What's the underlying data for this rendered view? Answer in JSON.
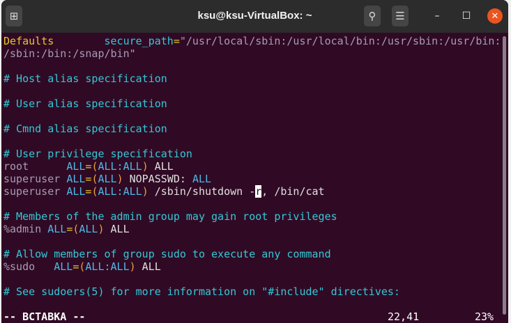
{
  "window": {
    "title": "ksu@ksu-VirtualBox: ~"
  },
  "titlebar": {
    "new_tab_icon": "new-tab-icon",
    "search_icon": "search-icon",
    "menu_icon": "hamburger-menu-icon",
    "minimize": "–",
    "maximize": "☐",
    "close": "✕"
  },
  "editor": {
    "lines": [
      [
        [
          "Defaults",
          "yellow"
        ],
        [
          "        ",
          "str"
        ],
        [
          "secure_path",
          "cyan"
        ],
        [
          "=",
          "op"
        ],
        [
          "\"/usr/local/sbin:/usr/local/bin:/usr/sbin:/usr/bin:",
          "str"
        ]
      ],
      [
        [
          "/sbin:/bin:/snap/bin\"",
          "str"
        ]
      ],
      [],
      [
        [
          "# Host alias specification",
          "cyan"
        ]
      ],
      [],
      [
        [
          "# User alias specification",
          "cyan"
        ]
      ],
      [],
      [
        [
          "# Cmnd alias specification",
          "cyan"
        ]
      ],
      [],
      [
        [
          "# User privilege specification",
          "cyan"
        ]
      ],
      [
        [
          "root      ",
          "str"
        ],
        [
          "ALL",
          "blue"
        ],
        [
          "=",
          "op"
        ],
        [
          "(",
          "paren"
        ],
        [
          "ALL:ALL",
          "blue"
        ],
        [
          ")",
          "paren"
        ],
        [
          " ALL",
          "plain"
        ]
      ],
      [
        [
          "superuser ",
          "str"
        ],
        [
          "ALL",
          "blue"
        ],
        [
          "=",
          "op"
        ],
        [
          "(",
          "paren"
        ],
        [
          "ALL",
          "blue"
        ],
        [
          ")",
          "paren"
        ],
        [
          " NOPASSWD",
          "plain"
        ],
        [
          ": ",
          "plain"
        ],
        [
          "ALL",
          "blue"
        ]
      ],
      [
        [
          "superuser ",
          "str"
        ],
        [
          "ALL",
          "blue"
        ],
        [
          "=",
          "op"
        ],
        [
          "(",
          "paren"
        ],
        [
          "ALL:ALL",
          "blue"
        ],
        [
          ")",
          "paren"
        ],
        [
          " /sbin/shutdown -",
          "plain"
        ],
        [
          "r",
          "cursor"
        ],
        [
          ", /bin/cat",
          "plain"
        ]
      ],
      [],
      [
        [
          "# Members of the admin group may gain root privileges",
          "cyan"
        ]
      ],
      [
        [
          "%admin ",
          "str"
        ],
        [
          "ALL",
          "blue"
        ],
        [
          "=",
          "op"
        ],
        [
          "(",
          "paren"
        ],
        [
          "ALL",
          "blue"
        ],
        [
          ")",
          "paren"
        ],
        [
          " ALL",
          "plain"
        ]
      ],
      [],
      [
        [
          "# Allow members of group sudo to execute any command",
          "cyan"
        ]
      ],
      [
        [
          "%sudo   ",
          "str"
        ],
        [
          "ALL",
          "blue"
        ],
        [
          "=",
          "op"
        ],
        [
          "(",
          "paren"
        ],
        [
          "ALL:ALL",
          "blue"
        ],
        [
          ")",
          "paren"
        ],
        [
          " ALL",
          "plain"
        ]
      ],
      [],
      [
        [
          "# See sudoers(5) for more information on \"#include\" directives:",
          "cyan"
        ]
      ]
    ]
  },
  "status": {
    "mode": "-- ВСТАВКА --",
    "position": "22,41",
    "percent": "23%"
  },
  "colors": {
    "background": "#300a24",
    "titlebar": "#2c2c2c",
    "close": "#e95420"
  }
}
